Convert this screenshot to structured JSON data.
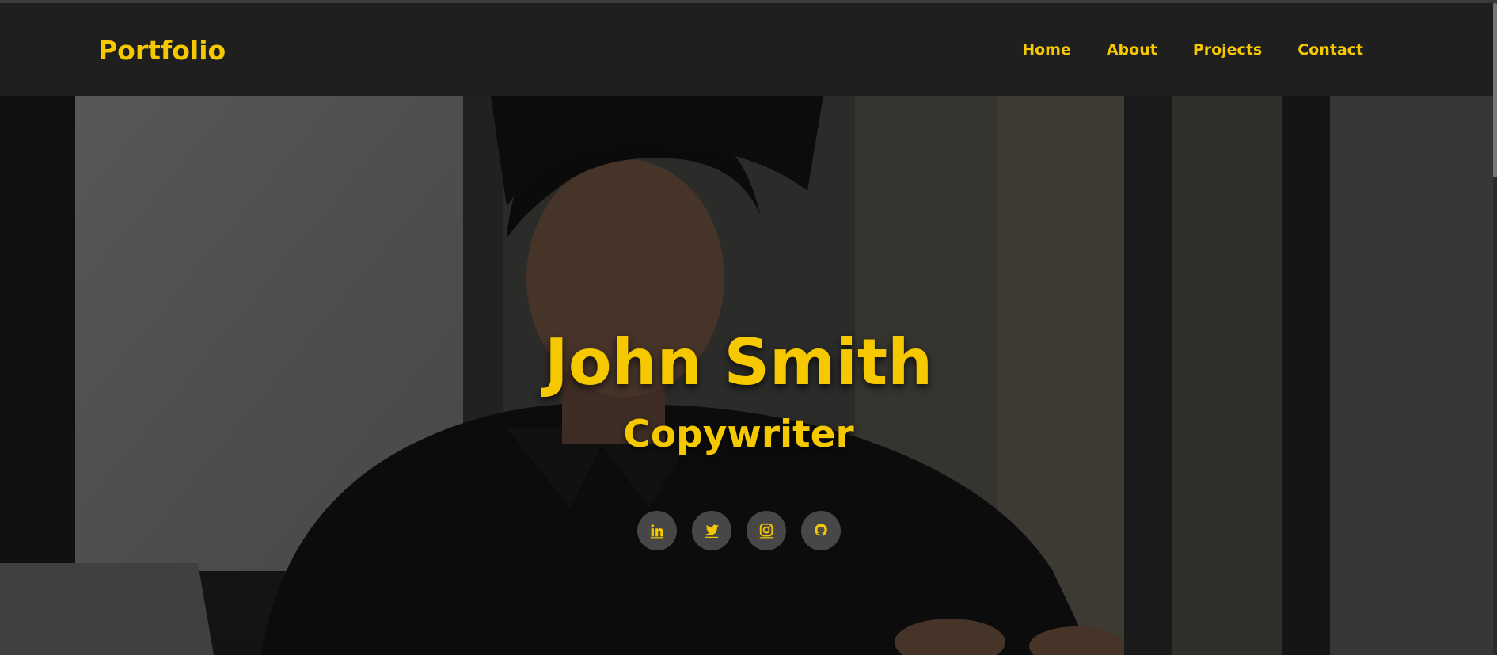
{
  "brand": "Portfolio",
  "nav": {
    "items": [
      {
        "label": "Home"
      },
      {
        "label": "About"
      },
      {
        "label": "Projects"
      },
      {
        "label": "Contact"
      }
    ]
  },
  "hero": {
    "name": "John Smith",
    "role": "Copywriter",
    "socials": [
      {
        "icon": "linkedin-icon"
      },
      {
        "icon": "twitter-icon"
      },
      {
        "icon": "instagram-icon"
      },
      {
        "icon": "github-icon"
      }
    ]
  },
  "colors": {
    "accent": "#f5c800",
    "navbar_bg": "#1f1f1f"
  }
}
